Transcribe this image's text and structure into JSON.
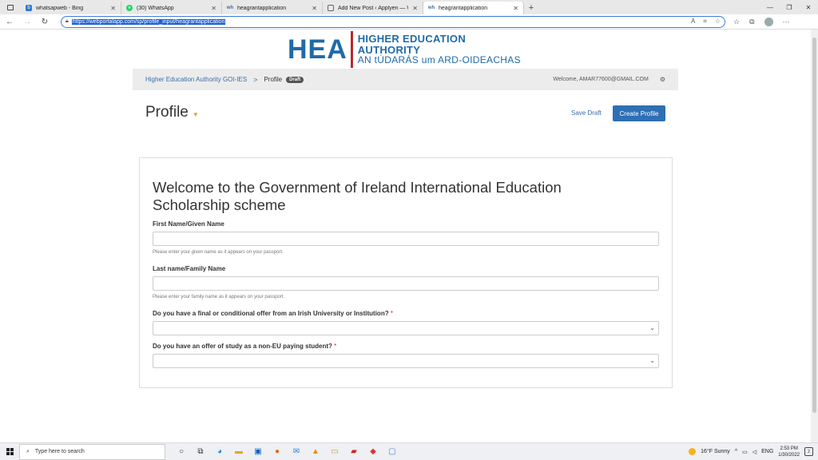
{
  "browser": {
    "tabs": [
      {
        "label": "whatsapweb - Bing",
        "favicon": "b"
      },
      {
        "label": "(30) WhatsApp",
        "favicon": "W"
      },
      {
        "label": "heagrantapplication",
        "favicon": "wh"
      },
      {
        "label": "Add New Post ‹ Applyen — Wor",
        "favicon": "doc"
      },
      {
        "label": "heagrantapplication",
        "favicon": "wh"
      }
    ],
    "url": "https://webportalapp.com/sp/profile_input/heagrantapplication"
  },
  "logo": {
    "abbr": "HEA",
    "name_en": "HIGHER EDUCATION AUTHORITY",
    "name_ga": "AN tÚDARÁS um ARD-OIDEACHAS"
  },
  "breadcrumb": {
    "home": "Higher Education Authority GOI-IES",
    "separator": ">",
    "current": "Profile",
    "badge": "Draft",
    "welcome": "Welcome, AMAR77600@GMAIL.COM"
  },
  "header": {
    "title": "Profile",
    "save_draft": "Save Draft",
    "create_profile": "Create Profile"
  },
  "form": {
    "heading": "Welcome to the Government of Ireland International Education Scholarship scheme",
    "first_name": {
      "label": "First Name/Given Name",
      "value": "",
      "help": "Please enter your given name as it appears on your passport."
    },
    "last_name": {
      "label": "Last name/Family Name",
      "value": "",
      "help": "Please enter your family name as it appears on your passport."
    },
    "offer": {
      "label": "Do you have a final or conditional offer from an Irish University or Institution?",
      "required": "*",
      "selected": ""
    },
    "non_eu": {
      "label": "Do you have an offer of study as a non-EU paying student?",
      "required": "*",
      "selected": ""
    }
  },
  "taskbar": {
    "search_placeholder": "Type here to search",
    "weather": "16°F  Sunny",
    "lang": "ENG",
    "time": "2:53 PM",
    "date": "1/30/2022",
    "notifications": "2"
  },
  "colors": {
    "brand_blue": "#1f6aa8",
    "brand_red": "#b8292f",
    "button_blue": "#2f6fb3"
  }
}
